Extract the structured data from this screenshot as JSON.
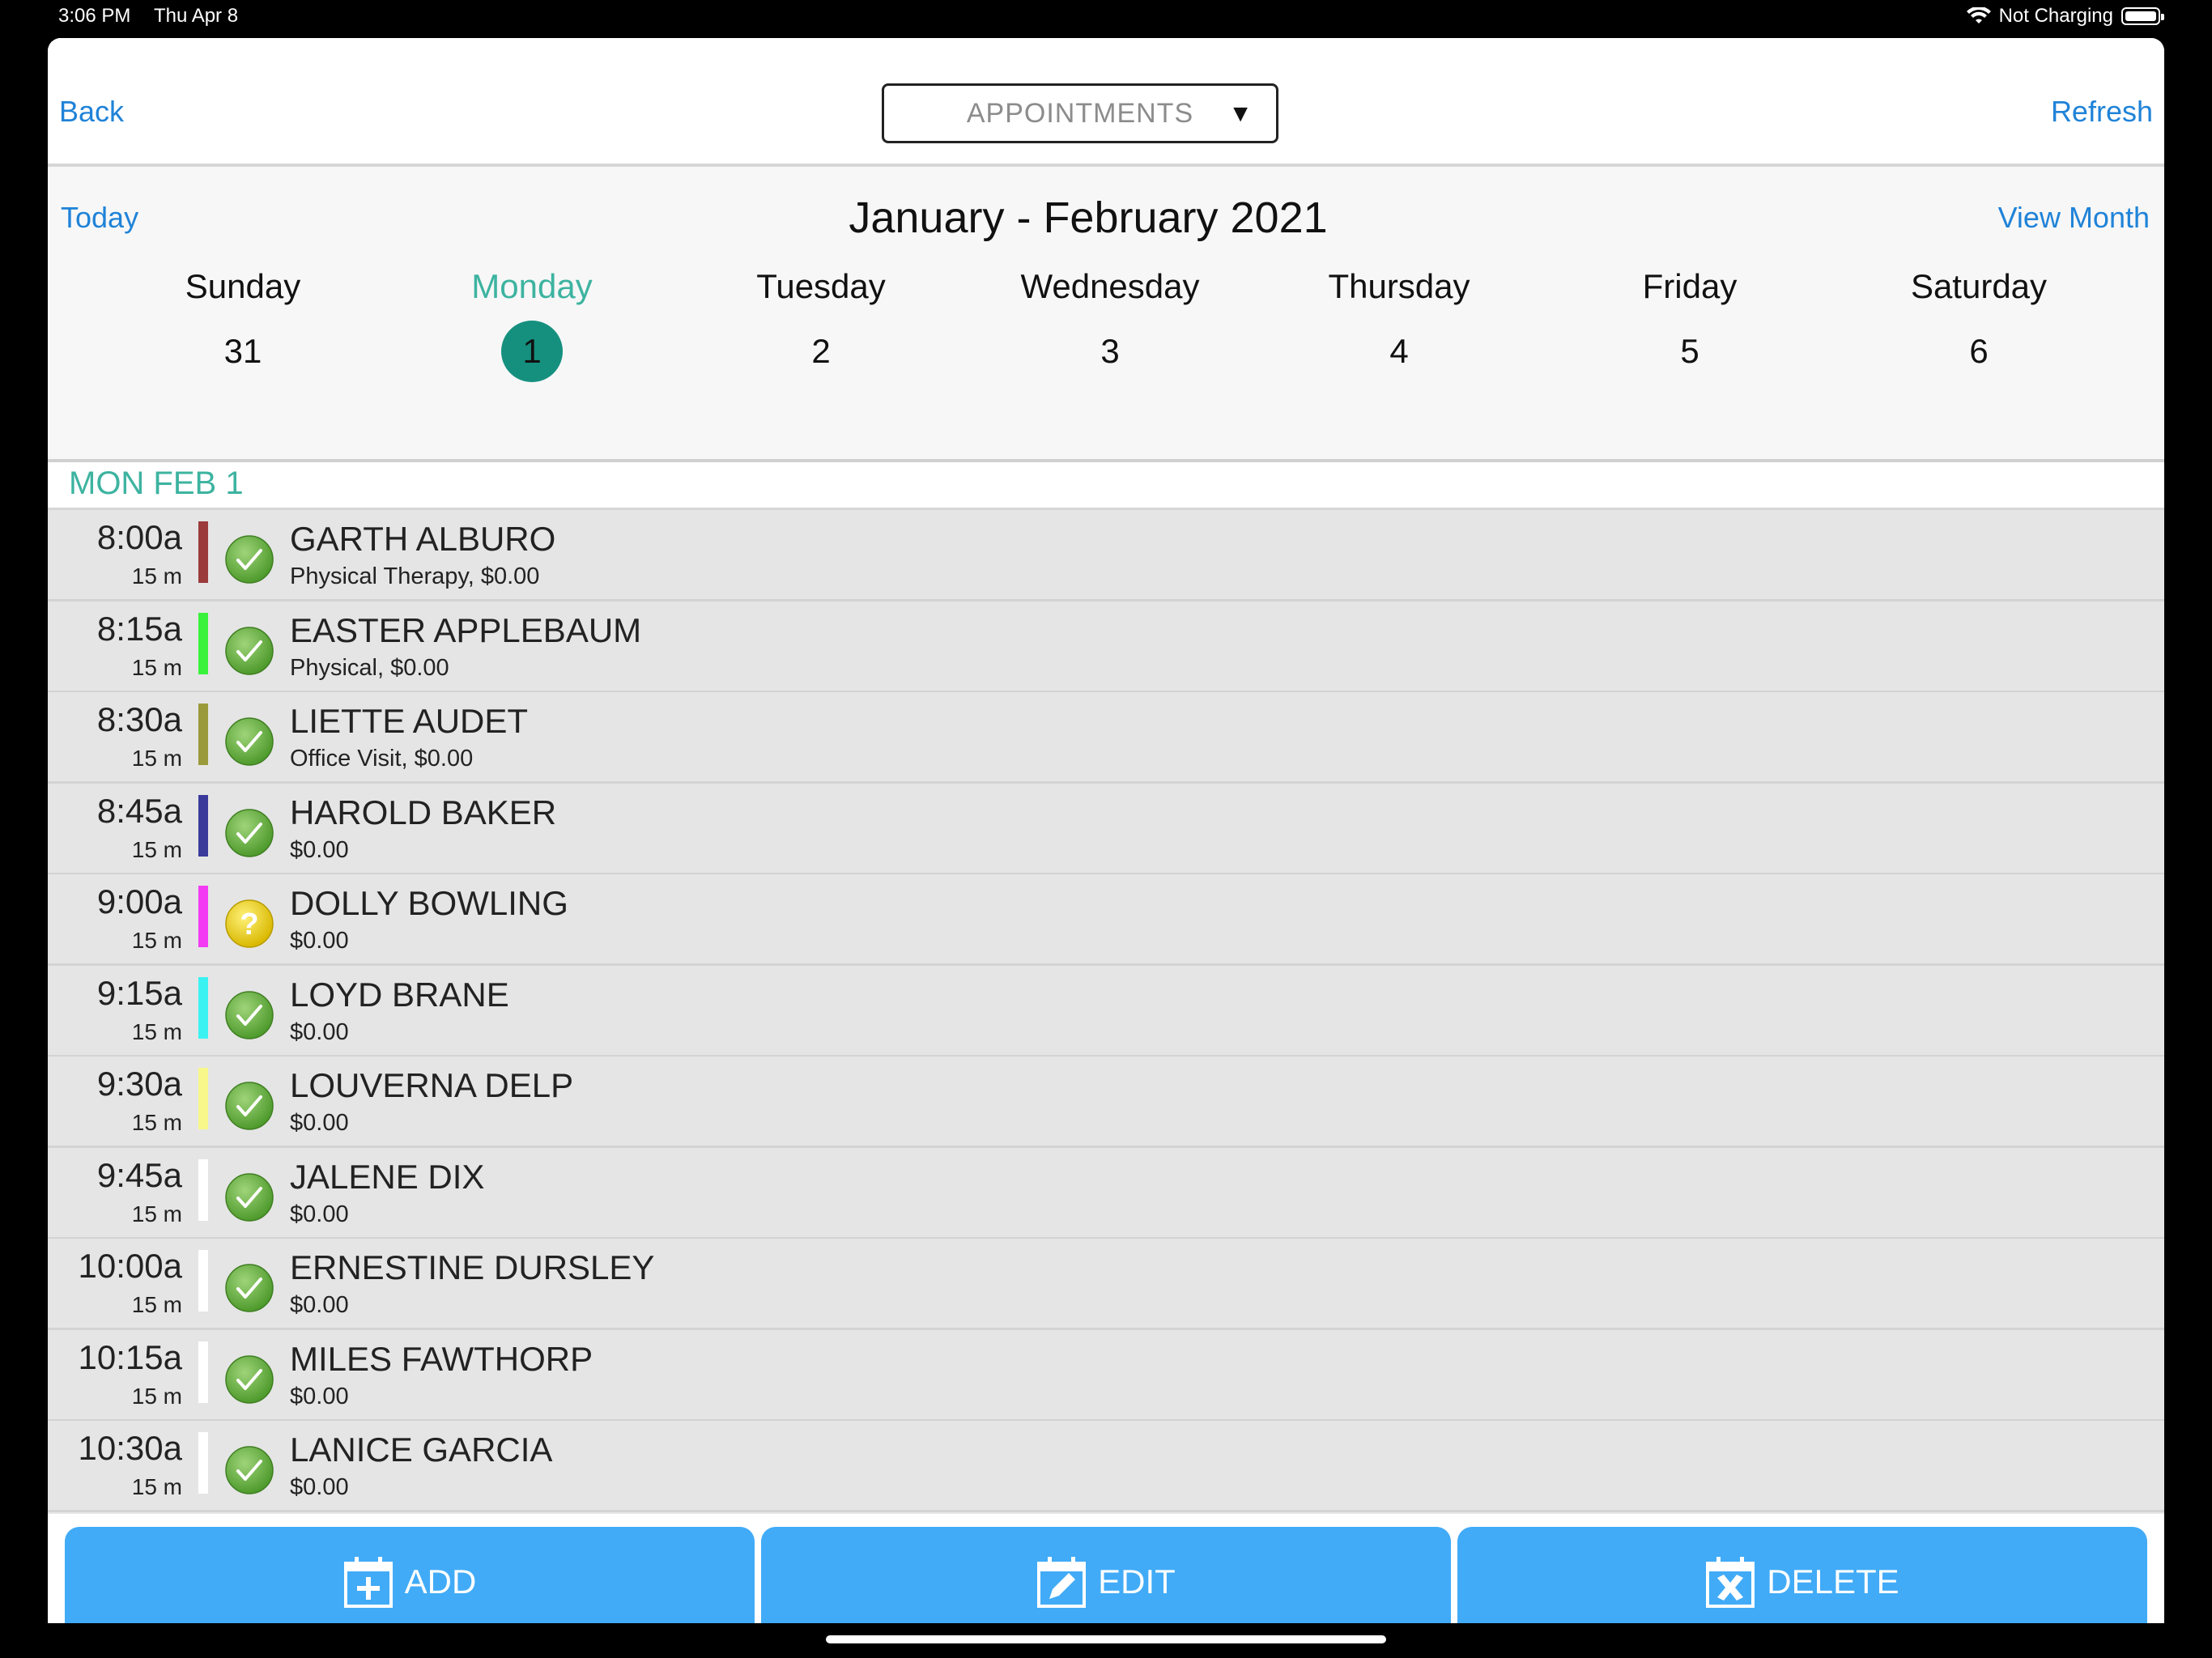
{
  "status_bar": {
    "time": "3:06 PM",
    "date": "Thu Apr 8",
    "charging": "Not Charging"
  },
  "nav": {
    "back": "Back",
    "refresh": "Refresh",
    "selector": "APPOINTMENTS"
  },
  "calendar": {
    "today": "Today",
    "title": "January - February 2021",
    "view_month": "View Month",
    "days": [
      {
        "name": "Sunday",
        "num": "31"
      },
      {
        "name": "Monday",
        "num": "1",
        "selected": true
      },
      {
        "name": "Tuesday",
        "num": "2"
      },
      {
        "name": "Wednesday",
        "num": "3"
      },
      {
        "name": "Thursday",
        "num": "4"
      },
      {
        "name": "Friday",
        "num": "5"
      },
      {
        "name": "Saturday",
        "num": "6"
      }
    ]
  },
  "section_header": "MON FEB 1",
  "appointments": [
    {
      "time": "8:00a",
      "duration": "15 m",
      "color": "#9b3b3b",
      "status": "confirmed",
      "status_icon": "check-icon",
      "name": "GARTH ALBURO",
      "detail": "Physical Therapy, $0.00"
    },
    {
      "time": "8:15a",
      "duration": "15 m",
      "color": "#39f23c",
      "status": "confirmed",
      "status_icon": "check-icon",
      "name": "EASTER APPLEBAUM",
      "detail": "Physical, $0.00"
    },
    {
      "time": "8:30a",
      "duration": "15 m",
      "color": "#9b9a3b",
      "status": "confirmed",
      "status_icon": "check-icon",
      "name": "LIETTE AUDET",
      "detail": "Office Visit, $0.00"
    },
    {
      "time": "8:45a",
      "duration": "15 m",
      "color": "#3a3a9b",
      "status": "confirmed",
      "status_icon": "check-icon",
      "name": "HAROLD BAKER",
      "detail": "$0.00"
    },
    {
      "time": "9:00a",
      "duration": "15 m",
      "color": "#f23bf2",
      "status": "unconfirmed",
      "status_icon": "question-icon",
      "name": "DOLLY BOWLING",
      "detail": "$0.00"
    },
    {
      "time": "9:15a",
      "duration": "15 m",
      "color": "#3bf2f2",
      "status": "confirmed",
      "status_icon": "check-icon",
      "name": "LOYD BRANE",
      "detail": "$0.00"
    },
    {
      "time": "9:30a",
      "duration": "15 m",
      "color": "#f7f78a",
      "status": "confirmed",
      "status_icon": "check-icon",
      "name": "LOUVERNA DELP",
      "detail": "$0.00"
    },
    {
      "time": "9:45a",
      "duration": "15 m",
      "color": "#ffffff",
      "status": "confirmed",
      "status_icon": "check-icon",
      "name": "JALENE DIX",
      "detail": "$0.00"
    },
    {
      "time": "10:00a",
      "duration": "15 m",
      "color": "#ffffff",
      "status": "confirmed",
      "status_icon": "check-icon",
      "name": "ERNESTINE DURSLEY",
      "detail": "$0.00"
    },
    {
      "time": "10:15a",
      "duration": "15 m",
      "color": "#ffffff",
      "status": "confirmed",
      "status_icon": "check-icon",
      "name": "MILES FAWTHORP",
      "detail": "$0.00"
    },
    {
      "time": "10:30a",
      "duration": "15 m",
      "color": "#ffffff",
      "status": "confirmed",
      "status_icon": "check-icon",
      "name": "LANICE GARCIA",
      "detail": "$0.00"
    }
  ],
  "toolbar": {
    "add": {
      "label": "ADD",
      "icon": "calendar-add-icon"
    },
    "edit": {
      "label": "EDIT",
      "icon": "calendar-edit-icon"
    },
    "delete": {
      "label": "DELETE",
      "icon": "calendar-delete-icon"
    }
  },
  "colors": {
    "accent": "#1f83d8",
    "teal": "#3db3a0",
    "selected_day": "#15907f",
    "button": "#41abf7"
  }
}
